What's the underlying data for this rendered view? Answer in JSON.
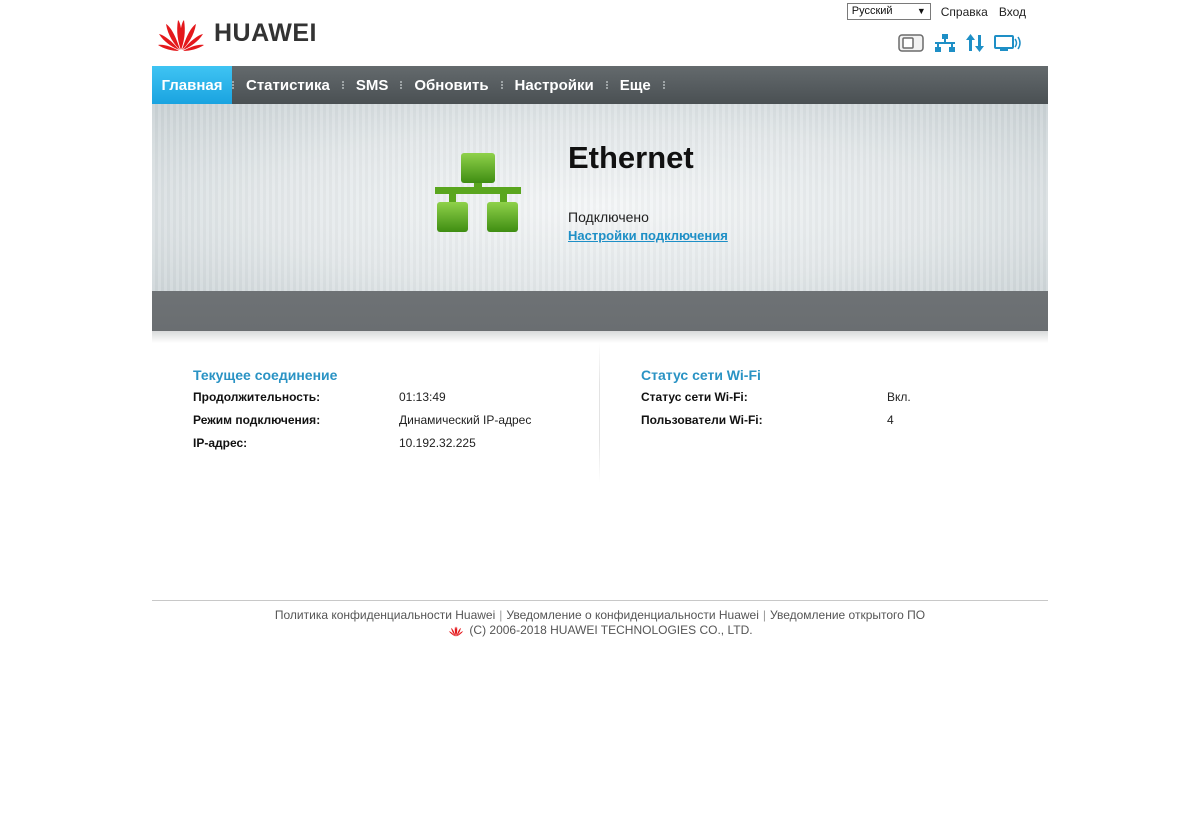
{
  "header": {
    "brand": "HUAWEI",
    "language": {
      "selected": "Русский"
    },
    "help_label": "Справка",
    "login_label": "Вход"
  },
  "status_icons": [
    "sim-icon",
    "lan-network-icon",
    "data-transfer-icon",
    "wifi-monitor-icon"
  ],
  "nav": {
    "items": [
      {
        "label": "Главная",
        "active": true
      },
      {
        "label": "Статистика"
      },
      {
        "label": "SMS"
      },
      {
        "label": "Обновить"
      },
      {
        "label": "Настройки"
      },
      {
        "label": "Еще"
      }
    ]
  },
  "banner": {
    "title": "Ethernet",
    "status": "Подключено",
    "settings_link": "Настройки подключения",
    "icon": "ethernet-network-icon",
    "icon_color": "#5aa61e"
  },
  "current_connection": {
    "title": "Текущее соединение",
    "rows": [
      {
        "label": "Продолжительность:",
        "value": "01:13:49"
      },
      {
        "label": "Режим подключения:",
        "value": "Динамический IP-адрес"
      },
      {
        "label": "IP-адрес:",
        "value": "10.192.32.225"
      }
    ]
  },
  "wifi_status": {
    "title": "Статус сети Wi-Fi",
    "rows": [
      {
        "label": "Статус сети Wi-Fi:",
        "value": "Вкл."
      },
      {
        "label": "Пользователи Wi-Fi:",
        "value": "4"
      }
    ]
  },
  "footer": {
    "links": [
      "Политика конфиденциальности Huawei",
      "Уведомление о конфиденциальности Huawei",
      "Уведомление открытого ПО"
    ],
    "copyright": "(C) 2006-2018 HUAWEI TECHNOLOGIES CO., LTD."
  },
  "colors": {
    "accent": "#1aa3e0",
    "link": "#1e8fc6",
    "section_title": "#2a93c4",
    "brand_red": "#e4181c"
  }
}
